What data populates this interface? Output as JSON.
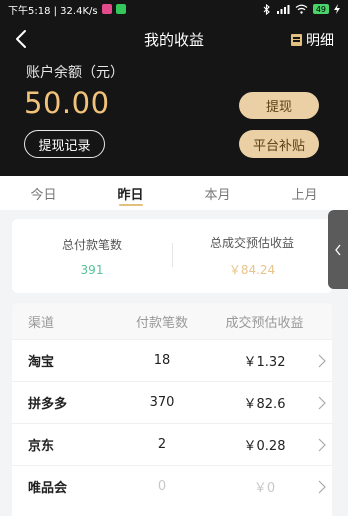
{
  "status": {
    "time_speed": "下午5:18 | 32.4K/s",
    "battery": "49"
  },
  "nav": {
    "title": "我的收益",
    "detail_label": "明细"
  },
  "balance": {
    "label": "账户余额（元）",
    "value": "50.00"
  },
  "buttons": {
    "withdraw": "提现",
    "withdraw_record": "提现记录",
    "subsidy": "平台补贴"
  },
  "tabs": [
    {
      "label": "今日",
      "active": false
    },
    {
      "label": "昨日",
      "active": true
    },
    {
      "label": "本月",
      "active": false
    },
    {
      "label": "上月",
      "active": false
    }
  ],
  "summary": {
    "total_orders_label": "总付款笔数",
    "total_orders_value": "391",
    "total_income_label": "总成交预估收益",
    "total_income_value": "￥84.24"
  },
  "table": {
    "headers": [
      "渠道",
      "付款笔数",
      "成交预估收益"
    ],
    "rows": [
      {
        "channel": "淘宝",
        "orders": "18",
        "income": "￥1.32"
      },
      {
        "channel": "拼多多",
        "orders": "370",
        "income": "￥82.6"
      },
      {
        "channel": "京东",
        "orders": "2",
        "income": "￥0.28"
      },
      {
        "channel": "唯品会",
        "orders": "0",
        "income": "￥0"
      }
    ]
  },
  "colors": {
    "gold": "#f1c37a",
    "button_bg": "#ead0a4",
    "green": "#54c39a",
    "dark": "#151515"
  },
  "icons": [
    "back-arrow-icon",
    "detail-list-icon",
    "chevron-right-icon",
    "chevron-left-icon",
    "bluetooth-icon",
    "signal-icon",
    "wifi-icon",
    "battery-icon"
  ]
}
